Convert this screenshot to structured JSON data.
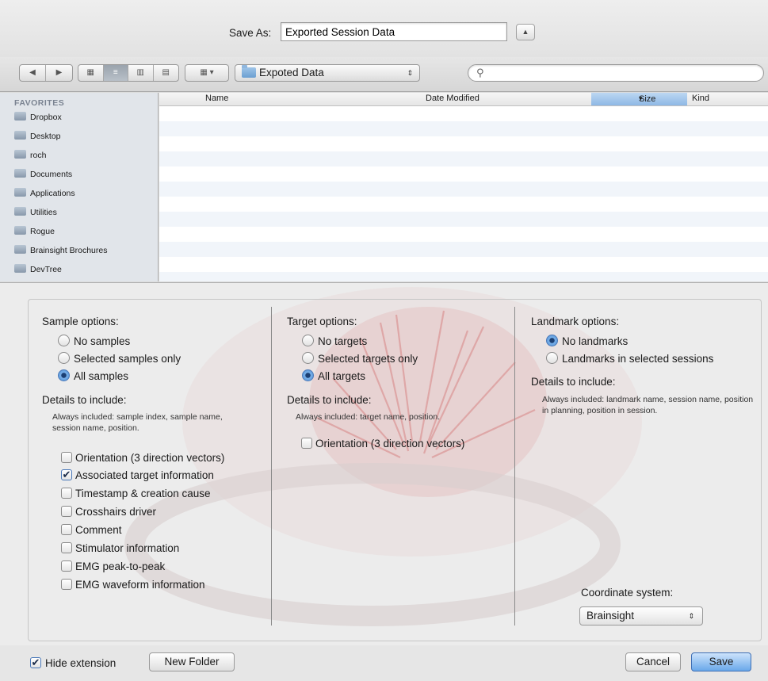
{
  "save_as": {
    "label": "Save As:",
    "filename": "Exported Session Data"
  },
  "toolbar": {
    "back_icon": "back-arrow-icon",
    "forward_icon": "forward-arrow-icon",
    "location": "Expoted Data",
    "search_placeholder": ""
  },
  "sidebar": {
    "heading": "FAVORITES",
    "items": [
      {
        "label": "Dropbox",
        "icon": "folder-icon"
      },
      {
        "label": "Desktop",
        "icon": "desktop-icon"
      },
      {
        "label": "roch",
        "icon": "home-icon"
      },
      {
        "label": "Documents",
        "icon": "documents-icon"
      },
      {
        "label": "Applications",
        "icon": "applications-icon"
      },
      {
        "label": "Utilities",
        "icon": "utilities-icon"
      },
      {
        "label": "Rogue",
        "icon": "folder-icon"
      },
      {
        "label": "Brainsight Brochures",
        "icon": "folder-icon"
      },
      {
        "label": "DevTree",
        "icon": "folder-icon"
      }
    ]
  },
  "file_list": {
    "columns": [
      "Name",
      "Date Modified",
      "Size",
      "Kind"
    ],
    "sorted_by": "Size"
  },
  "sample_options": {
    "heading": "Sample options:",
    "radios": [
      {
        "label": "No samples",
        "selected": false
      },
      {
        "label": "Selected samples only",
        "selected": false
      },
      {
        "label": "All samples",
        "selected": true
      }
    ],
    "details_heading": "Details to include:",
    "always_included": "Always included: sample index, sample name, session name, position.",
    "checks": [
      {
        "label": "Orientation (3 direction vectors)",
        "checked": false
      },
      {
        "label": "Associated target information",
        "checked": true
      },
      {
        "label": "Timestamp & creation cause",
        "checked": false
      },
      {
        "label": "Crosshairs driver",
        "checked": false
      },
      {
        "label": "Comment",
        "checked": false
      },
      {
        "label": "Stimulator information",
        "checked": false
      },
      {
        "label": "EMG peak-to-peak",
        "checked": false
      },
      {
        "label": "EMG waveform information",
        "checked": false
      }
    ]
  },
  "target_options": {
    "heading": "Target options:",
    "radios": [
      {
        "label": "No targets",
        "selected": false
      },
      {
        "label": "Selected targets only",
        "selected": false
      },
      {
        "label": "All targets",
        "selected": true
      }
    ],
    "details_heading": "Details to include:",
    "always_included": "Always included: target name, position.",
    "checks": [
      {
        "label": "Orientation (3 direction vectors)",
        "checked": false
      }
    ]
  },
  "landmark_options": {
    "heading": "Landmark options:",
    "radios": [
      {
        "label": "No landmarks",
        "selected": true
      },
      {
        "label": "Landmarks in selected sessions",
        "selected": false
      }
    ],
    "details_heading": "Details to include:",
    "always_included": "Always included: landmark name, session name, position in planning, position in session."
  },
  "coordinate_system": {
    "label": "Coordinate system:",
    "value": "Brainsight"
  },
  "bottom": {
    "hide_extension": {
      "label": "Hide extension",
      "checked": true
    },
    "new_folder": "New Folder",
    "cancel": "Cancel",
    "save": "Save"
  },
  "colors": {
    "accent": "#6aa8ea",
    "sidebar_bg": "#e1e5ea"
  }
}
